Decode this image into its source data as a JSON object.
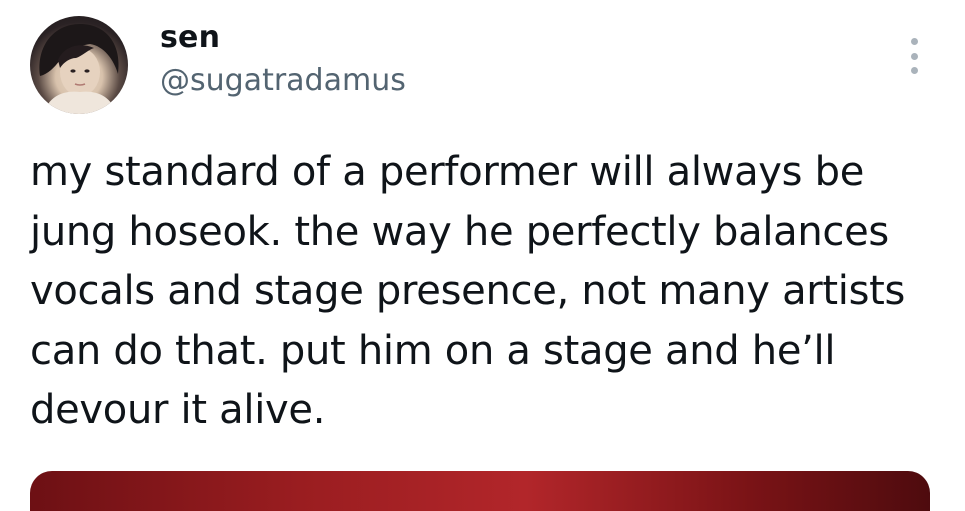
{
  "tweet": {
    "author": {
      "display_name": "sen",
      "handle": "@sugatradamus",
      "avatar_icon": "profile-photo"
    },
    "more_icon": "more-vertical-icon",
    "text": "my standard of a performer will always be\njung hoseok. the way he perfectly balances\nvocals and stage presence, not many artists\ncan do that. put him on a stage and he’ll\ndevour it alive.",
    "media": {
      "type": "image",
      "accent_color": "#9a1d20"
    }
  }
}
